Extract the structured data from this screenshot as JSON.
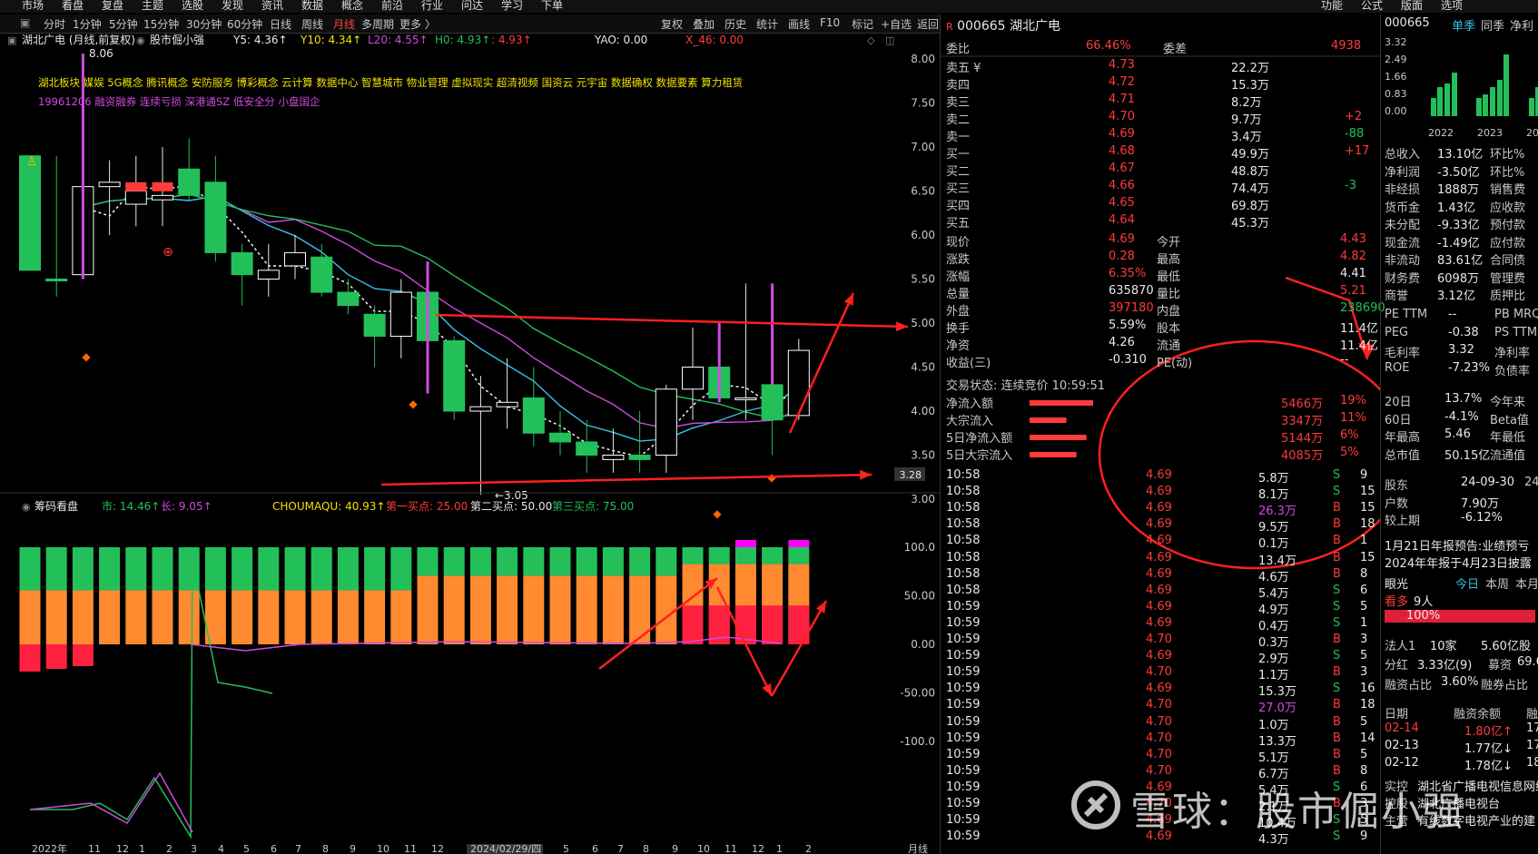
{
  "top_menu": [
    "市场",
    "看盘",
    "复盘",
    "主题",
    "选股",
    "发现",
    "资讯",
    "数据",
    "概念",
    "前沿",
    "行业",
    "问达",
    "学习",
    "下单"
  ],
  "top_menu_right": [
    "功能",
    "公式",
    "版面",
    "选项"
  ],
  "period_tabs": [
    "分时",
    "1分钟",
    "5分钟",
    "15分钟",
    "30分钟",
    "60分钟",
    "日线",
    "周线",
    "月线",
    "多周期",
    "更多 〉"
  ],
  "active_period": "月线",
  "toolbar": [
    "复权",
    "叠加",
    "历史",
    "统计",
    "画线",
    "F10",
    "标记",
    "+自选",
    "返回"
  ],
  "chart": {
    "title": "湖北广电 (月线,前复权)",
    "tag": "股市倔小强",
    "ma": [
      {
        "label": "Y5: 4.36↑",
        "color": "#e8e8e8"
      },
      {
        "label": "Y10: 4.34↑",
        "color": "#f0e000"
      },
      {
        "label": "L20: 4.55↑",
        "color": "#d04ae0"
      },
      {
        "label": "H0: 4.93↑",
        "color": "#23c05a"
      },
      {
        "label": ": 4.93↑",
        "color": "#ff3b3b"
      }
    ],
    "yao": "YAO: 0.00",
    "x46": "X_46: 0.00",
    "concepts_line1": "湖北板块 媒娱 5G概念 腾讯概念 安防服务 博彩概念 云计算 数据中心 智慧城市 物业管理 虚拟现实 超清视频 国资云 元宇宙 数据确权 数据要素 算力租赁",
    "concepts_line2": "19961206 融资融券 连续亏损 深港通SZ 低安全分 小盘国企",
    "high_label": "8.06",
    "low_label": "←3.05",
    "price_axis": [
      "8.00",
      "7.50",
      "7.00",
      "6.50",
      "6.00",
      "5.50",
      "5.00",
      "4.50",
      "4.00",
      "3.50",
      "3.00"
    ],
    "current_marker": "3.28",
    "x_axis": [
      "2022年",
      "11",
      "12",
      "1",
      "2",
      "3",
      "4",
      "5",
      "6",
      "7",
      "8",
      "9",
      "10",
      "11",
      "12",
      "2024/02/29/四",
      "5",
      "6",
      "7",
      "8",
      "9",
      "10",
      "11",
      "12",
      "1",
      "2"
    ],
    "x_axis_end": "月线",
    "candles": [
      {
        "o": 5.6,
        "c": 6.9,
        "h": 6.9,
        "l": 5.6,
        "up": false
      },
      {
        "o": 5.5,
        "c": 5.5,
        "h": 6.9,
        "l": 5.3,
        "up": false
      },
      {
        "o": 5.55,
        "c": 6.55,
        "h": 8.06,
        "l": 5.5,
        "up": true
      },
      {
        "o": 6.55,
        "c": 6.6,
        "h": 6.85,
        "l": 6.0,
        "up": true
      },
      {
        "o": 6.35,
        "c": 6.5,
        "h": 6.9,
        "l": 6.1,
        "up": true
      },
      {
        "o": 6.4,
        "c": 6.45,
        "h": 7.0,
        "l": 6.1,
        "up": true
      },
      {
        "o": 6.45,
        "c": 6.75,
        "h": 7.1,
        "l": 6.4,
        "up": false
      },
      {
        "o": 6.6,
        "c": 5.8,
        "h": 6.9,
        "l": 5.7,
        "up": false
      },
      {
        "o": 5.8,
        "c": 5.55,
        "h": 5.9,
        "l": 5.2,
        "up": false
      },
      {
        "o": 5.5,
        "c": 5.6,
        "h": 5.9,
        "l": 5.3,
        "up": true
      },
      {
        "o": 5.65,
        "c": 5.8,
        "h": 6.0,
        "l": 5.5,
        "up": true
      },
      {
        "o": 5.75,
        "c": 5.35,
        "h": 5.9,
        "l": 5.3,
        "up": false
      },
      {
        "o": 5.35,
        "c": 5.2,
        "h": 5.5,
        "l": 5.1,
        "up": false
      },
      {
        "o": 5.1,
        "c": 4.85,
        "h": 5.2,
        "l": 4.5,
        "up": false
      },
      {
        "o": 4.85,
        "c": 5.35,
        "h": 5.5,
        "l": 4.6,
        "up": true
      },
      {
        "o": 5.35,
        "c": 4.8,
        "h": 5.5,
        "l": 4.7,
        "up": false
      },
      {
        "o": 4.8,
        "c": 4.0,
        "h": 4.85,
        "l": 3.9,
        "up": false
      },
      {
        "o": 4.0,
        "c": 4.05,
        "h": 4.4,
        "l": 3.05,
        "up": true
      },
      {
        "o": 4.05,
        "c": 4.1,
        "h": 4.6,
        "l": 3.8,
        "up": true
      },
      {
        "o": 4.15,
        "c": 3.75,
        "h": 4.5,
        "l": 3.6,
        "up": false
      },
      {
        "o": 3.75,
        "c": 3.65,
        "h": 4.0,
        "l": 3.5,
        "up": false
      },
      {
        "o": 3.65,
        "c": 3.5,
        "h": 3.9,
        "l": 3.3,
        "up": false
      },
      {
        "o": 3.45,
        "c": 3.5,
        "h": 3.8,
        "l": 3.3,
        "up": true
      },
      {
        "o": 3.5,
        "c": 3.45,
        "h": 4.0,
        "l": 3.3,
        "up": false
      },
      {
        "o": 3.5,
        "c": 4.25,
        "h": 4.3,
        "l": 3.3,
        "up": true
      },
      {
        "o": 4.25,
        "c": 4.5,
        "h": 4.95,
        "l": 3.9,
        "up": true
      },
      {
        "o": 4.5,
        "c": 4.15,
        "h": 4.85,
        "l": 4.1,
        "up": false
      },
      {
        "o": 4.15,
        "c": 4.15,
        "h": 5.45,
        "l": 3.9,
        "up": true
      },
      {
        "o": 4.3,
        "c": 3.9,
        "h": 4.4,
        "l": 3.5,
        "up": false
      },
      {
        "o": 3.95,
        "c": 4.69,
        "h": 4.82,
        "l": 3.9,
        "up": true
      }
    ],
    "sub": {
      "title": "筹码看盘",
      "shi": "市: 14.46↑",
      "zhang": "长: 9.05↑",
      "choumaqu": "CHOUMAQU: 40.93↑",
      "buy1": "第一买点: 25.00",
      "buy2": "第二买点: 50.00",
      "buy3": "第三买点: 75.00",
      "axis": [
        "100.0",
        "50.00",
        "0.00",
        "-50.00",
        "-100.0"
      ]
    }
  },
  "quote": {
    "code": "000665",
    "name": "湖北广电",
    "weibi_label": "委比",
    "weibi": "66.46%",
    "weicha_label": "委差",
    "weicha": "4938",
    "asks": [
      {
        "label": "卖五 ¥",
        "price": "4.73",
        "vol": "22.2万",
        "chg": ""
      },
      {
        "label": "卖四",
        "price": "4.72",
        "vol": "15.3万",
        "chg": ""
      },
      {
        "label": "卖三",
        "price": "4.71",
        "vol": "8.2万",
        "chg": ""
      },
      {
        "label": "卖二",
        "price": "4.70",
        "vol": "9.7万",
        "chg": "+2"
      },
      {
        "label": "卖一",
        "price": "4.69",
        "vol": "3.4万",
        "chg": "-88"
      }
    ],
    "bids": [
      {
        "label": "买一",
        "price": "4.68",
        "vol": "49.9万",
        "chg": "+17"
      },
      {
        "label": "买二",
        "price": "4.67",
        "vol": "48.8万",
        "chg": ""
      },
      {
        "label": "买三",
        "price": "4.66",
        "vol": "74.4万",
        "chg": "-3"
      },
      {
        "label": "买四",
        "price": "4.65",
        "vol": "69.8万",
        "chg": ""
      },
      {
        "label": "买五",
        "price": "4.64",
        "vol": "45.3万",
        "chg": ""
      }
    ],
    "stats": [
      {
        "l1": "现价",
        "v1": "4.69",
        "l2": "今开",
        "v2": "4.43",
        "c1": "red",
        "c2": "red"
      },
      {
        "l1": "涨跌",
        "v1": "0.28",
        "l2": "最高",
        "v2": "4.82",
        "c1": "red",
        "c2": "red"
      },
      {
        "l1": "涨幅",
        "v1": "6.35%",
        "l2": "最低",
        "v2": "4.41",
        "c1": "red",
        "c2": "white"
      },
      {
        "l1": "总量",
        "v1": "635870",
        "l2": "量比",
        "v2": "5.21",
        "c1": "white",
        "c2": "red"
      },
      {
        "l1": "外盘",
        "v1": "397180",
        "l2": "内盘",
        "v2": "238690",
        "c1": "red",
        "c2": "green"
      },
      {
        "l1": "换手",
        "v1": "5.59%",
        "l2": "股本",
        "v2": "11.4亿",
        "c1": "white",
        "c2": "white"
      },
      {
        "l1": "净资",
        "v1": "4.26",
        "l2": "流通",
        "v2": "11.4亿",
        "c1": "white",
        "c2": "white"
      },
      {
        "l1": "收益(三)",
        "v1": "-0.310",
        "l2": "PE(动)",
        "v2": "--",
        "c1": "white",
        "c2": "white"
      }
    ],
    "status": "交易状态: 连续竞价 10:59:51",
    "flows": [
      {
        "label": "净流入额",
        "val": "5466万",
        "pct": "19%",
        "bar": 0.19
      },
      {
        "label": "大宗流入",
        "val": "3347万",
        "pct": "11%",
        "bar": 0.11
      },
      {
        "label": "5日净流入额",
        "val": "5144万",
        "pct": "6%",
        "bar": 0.17
      },
      {
        "label": "5日大宗流入",
        "val": "4085万",
        "pct": "5%",
        "bar": 0.14
      }
    ],
    "ticks": [
      {
        "t": "10:58",
        "p": "4.69",
        "v": "5.8万",
        "bs": "S",
        "n": "9"
      },
      {
        "t": "10:58",
        "p": "4.69",
        "v": "8.1万",
        "bs": "S",
        "n": "15"
      },
      {
        "t": "10:58",
        "p": "4.69",
        "v": "26.3万",
        "bs": "B",
        "n": "15"
      },
      {
        "t": "10:58",
        "p": "4.69",
        "v": "9.5万",
        "bs": "B",
        "n": "18"
      },
      {
        "t": "10:58",
        "p": "4.69",
        "v": "0.1万",
        "bs": "B",
        "n": "1"
      },
      {
        "t": "10:58",
        "p": "4.69",
        "v": "13.4万",
        "bs": "B",
        "n": "15"
      },
      {
        "t": "10:58",
        "p": "4.69",
        "v": "4.6万",
        "bs": "B",
        "n": "8"
      },
      {
        "t": "10:58",
        "p": "4.69",
        "v": "5.4万",
        "bs": "S",
        "n": "6"
      },
      {
        "t": "10:59",
        "p": "4.69",
        "v": "4.9万",
        "bs": "S",
        "n": "5"
      },
      {
        "t": "10:59",
        "p": "4.69",
        "v": "0.4万",
        "bs": "S",
        "n": "1"
      },
      {
        "t": "10:59",
        "p": "4.70",
        "v": "0.3万",
        "bs": "B",
        "n": "3"
      },
      {
        "t": "10:59",
        "p": "4.69",
        "v": "2.9万",
        "bs": "S",
        "n": "5"
      },
      {
        "t": "10:59",
        "p": "4.70",
        "v": "1.1万",
        "bs": "B",
        "n": "3"
      },
      {
        "t": "10:59",
        "p": "4.69",
        "v": "15.3万",
        "bs": "S",
        "n": "16"
      },
      {
        "t": "10:59",
        "p": "4.70",
        "v": "27.0万",
        "bs": "B",
        "n": "18"
      },
      {
        "t": "10:59",
        "p": "4.70",
        "v": "1.0万",
        "bs": "B",
        "n": "5"
      },
      {
        "t": "10:59",
        "p": "4.70",
        "v": "13.3万",
        "bs": "B",
        "n": "14"
      },
      {
        "t": "10:59",
        "p": "4.70",
        "v": "5.1万",
        "bs": "B",
        "n": "5"
      },
      {
        "t": "10:59",
        "p": "4.70",
        "v": "6.7万",
        "bs": "B",
        "n": "8"
      },
      {
        "t": "10:59",
        "p": "4.69",
        "v": "5.4万",
        "bs": "S",
        "n": "6"
      },
      {
        "t": "10:59",
        "p": "4.70",
        "v": "2.1万",
        "bs": "B",
        "n": "3"
      },
      {
        "t": "10:59",
        "p": "4.69",
        "v": "10.4万",
        "bs": "S",
        "n": "5"
      },
      {
        "t": "10:59",
        "p": "4.69",
        "v": "4.3万",
        "bs": "S",
        "n": "9"
      }
    ]
  },
  "far": {
    "code": "000665",
    "tabs": [
      "单季",
      "同季",
      "净利"
    ],
    "bar_axis": [
      "3.32",
      "2.49",
      "1.66",
      "0.83",
      "0.00"
    ],
    "years": [
      "2022",
      "2023",
      "20"
    ],
    "bars": [
      0.25,
      0.4,
      0.45,
      0.6,
      0.25,
      0.3,
      0.4,
      0.5,
      0.85,
      0.25,
      0.4
    ],
    "fin": [
      {
        "k": "总收入",
        "v": "13.10亿",
        "k2": "环比%"
      },
      {
        "k": "净利润",
        "v": "-3.50亿",
        "k2": "环比%"
      },
      {
        "k": "非经损",
        "v": "1888万",
        "k2": "销售费"
      },
      {
        "k": "货币金",
        "v": "1.43亿",
        "k2": "应收款"
      },
      {
        "k": "未分配",
        "v": "-9.33亿",
        "k2": "预付款"
      },
      {
        "k": "现金流",
        "v": "-1.49亿",
        "k2": "应付款"
      },
      {
        "k": "非流动",
        "v": "83.61亿",
        "k2": "合同债"
      },
      {
        "k": "财务费",
        "v": "6098万",
        "k2": "管理费"
      },
      {
        "k": "商誉",
        "v": "3.12亿",
        "k2": "质押比"
      }
    ],
    "val": [
      {
        "k": "PE TTM",
        "v": "--",
        "k2": "PB MRQ"
      },
      {
        "k": "PEG",
        "v": "-0.38",
        "k2": "PS TTM"
      },
      {
        "k": "毛利率",
        "v": "3.32",
        "k2": "净利率"
      },
      {
        "k": "ROE",
        "v": "-7.23%",
        "k2": "负债率"
      }
    ],
    "perf": [
      {
        "k": "20日",
        "v": "13.7%",
        "k2": "今年来"
      },
      {
        "k": "60日",
        "v": "-4.1%",
        "k2": "Beta值"
      },
      {
        "k": "年最高",
        "v": "5.46",
        "k2": "年最低"
      },
      {
        "k": "总市值",
        "v": "50.15亿",
        "k2": "流通值"
      }
    ],
    "holders": [
      {
        "k": "股东",
        "v": "24-09-30",
        "k2": "24"
      },
      {
        "k": "户数",
        "v": "7.90万",
        "k2": ""
      },
      {
        "k": "较上期",
        "v": "-6.12%",
        "k2": ""
      }
    ],
    "notice1": "1月21日年报预告:业绩预亏",
    "notice2": "2024年年报于4月23日披露",
    "eye": "眼光",
    "eye_tabs": [
      "今日",
      "本周",
      "本月"
    ],
    "bull_label": "看多",
    "bull_count": "9人",
    "bull_pct": "100%",
    "legal": "法人1",
    "legal_firms": "10家",
    "legal_amt": "5.60亿股",
    "dividend": "分红",
    "dividend_v": "3.33亿(9)",
    "raise": "募资",
    "raise_v": "69.6",
    "margin": "融资占比",
    "margin_v": "3.60%",
    "short": "融券占比",
    "margin_hdr": [
      "日期",
      "融资余额",
      "融"
    ],
    "margin_rows": [
      {
        "d": "02-14",
        "v": "1.80亿↑",
        "n": "17"
      },
      {
        "d": "02-13",
        "v": "1.77亿↓",
        "n": "17"
      },
      {
        "d": "02-12",
        "v": "1.78亿↓",
        "n": "18"
      }
    ],
    "ctrl_label": "控股",
    "ctrl_v": "湖北广播电视台",
    "hold_label": "实控",
    "hold_v": "湖北省广播电视信息网络",
    "main_biz": "主营",
    "main_biz_v": "有线数字电视产业的建"
  },
  "watermark": "雪球：股市倔小强"
}
